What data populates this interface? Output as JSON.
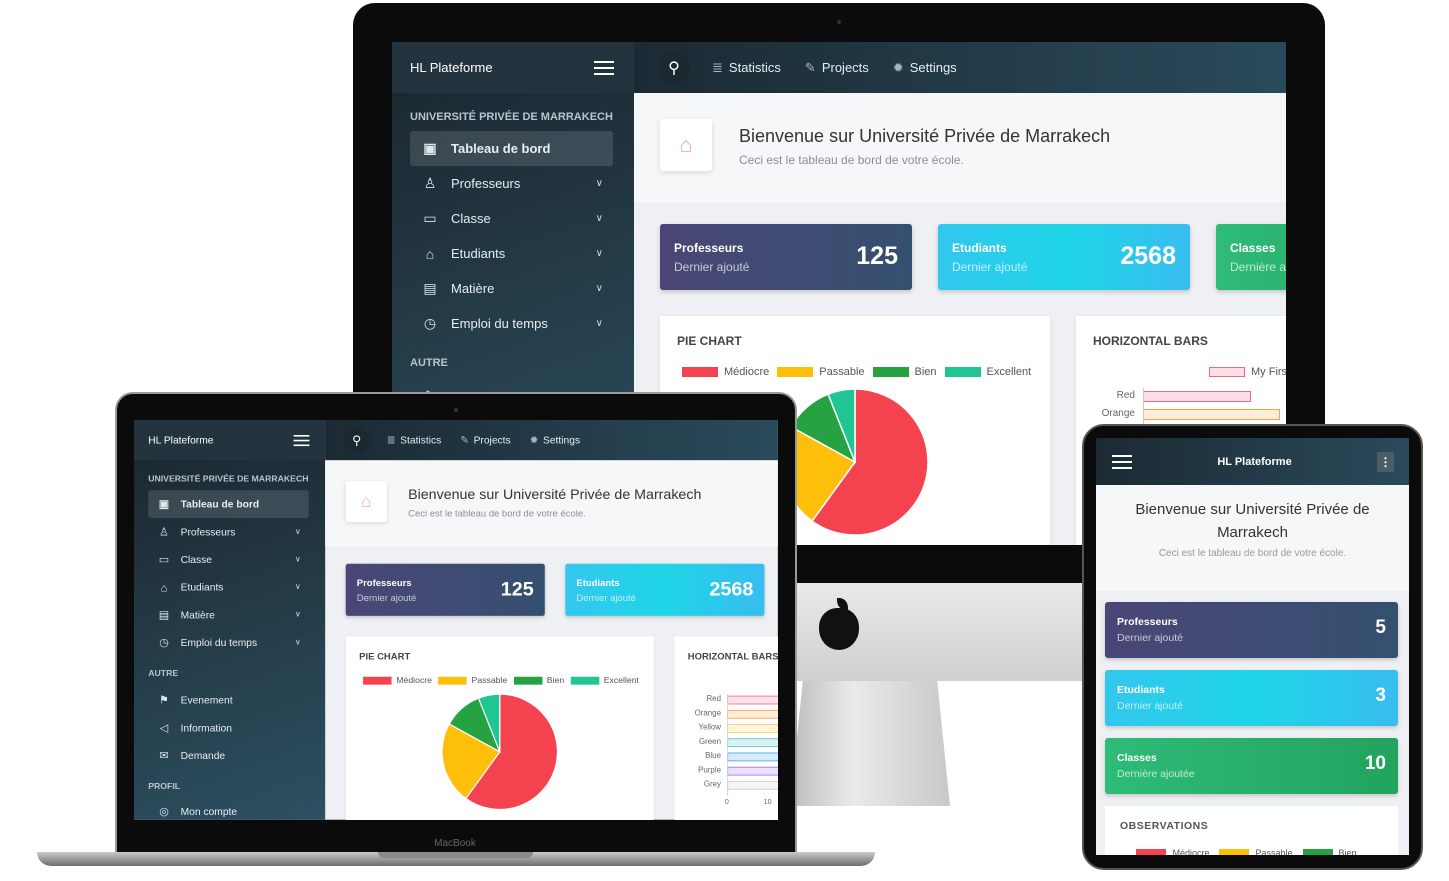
{
  "brand": "HL Plateforme",
  "sidebar": {
    "section_title": "UNIVERSITÉ PRIVÉE DE MARRAKECH",
    "items": [
      {
        "label": "Tableau de bord",
        "icon": "presentation-board-icon",
        "active": true
      },
      {
        "label": "Professeurs",
        "icon": "users-icon"
      },
      {
        "label": "Classe",
        "icon": "folder-icon"
      },
      {
        "label": "Etudiants",
        "icon": "graduation-cap-icon"
      },
      {
        "label": "Matière",
        "icon": "clipboard-icon"
      },
      {
        "label": "Emploi du temps",
        "icon": "alarm-clock-icon"
      }
    ],
    "other_title": "AUTRE",
    "other_items": [
      {
        "label": "Evenement",
        "icon": "signpost-icon"
      },
      {
        "label": "Information",
        "icon": "megaphone-icon"
      },
      {
        "label": "Demande",
        "icon": "envelope-icon"
      }
    ],
    "profile_title": "PROFIL",
    "profile_items": [
      {
        "label": "Mon compte",
        "icon": "user-circle-icon"
      }
    ]
  },
  "topnav": [
    {
      "label": "Statistics",
      "icon": "database-icon"
    },
    {
      "label": "Projects",
      "icon": "edit-icon"
    },
    {
      "label": "Settings",
      "icon": "gear-icon"
    }
  ],
  "welcome": {
    "title": "Bienvenue sur Université Privée de Marrakech",
    "subtitle": "Ceci est le tableau de bord de votre école."
  },
  "stats": [
    {
      "title": "Professeurs",
      "subtitle": "Dernier ajouté",
      "value": "125",
      "color": "#4a4677"
    },
    {
      "title": "Etudiants",
      "subtitle": "Dernier ajouté",
      "value": "2568",
      "color": "#1ed5e6"
    },
    {
      "title": "Classes",
      "subtitle": "Dernière ajoutée",
      "value": "10",
      "color": "#2fbb78"
    }
  ],
  "tablet_stats": [
    {
      "title": "Professeurs",
      "subtitle": "Dernier ajouté",
      "value": "5"
    },
    {
      "title": "Etudiants",
      "subtitle": "Dernier ajouté",
      "value": "3"
    },
    {
      "title": "Classes",
      "subtitle": "Dernière ajoutée",
      "value": "10"
    }
  ],
  "observations_title": "OBSERVATIONS",
  "device_label": "MacBook",
  "chart_data": [
    {
      "type": "pie",
      "title": "PIE CHART",
      "categories": [
        "Médiocre",
        "Passable",
        "Bien",
        "Excellent"
      ],
      "values": [
        60,
        23,
        11,
        6
      ],
      "colors": [
        "#f5424f",
        "#fdbf0a",
        "#27a243",
        "#1fc593"
      ],
      "legend": "top"
    },
    {
      "type": "bar",
      "orientation": "horizontal",
      "title": "HORIZONTAL BARS",
      "series": [
        {
          "name": "My First"
        }
      ],
      "categories": [
        "Red",
        "Orange",
        "Yellow",
        "Green",
        "Blue",
        "Purple",
        "Grey"
      ],
      "values": [
        22,
        28,
        28,
        28,
        28,
        28,
        28
      ],
      "colors": [
        "#ff6384",
        "#ff9f40",
        "#ffcd56",
        "#4bc0c0",
        "#36a2eb",
        "#9966ff",
        "#c9cbcf"
      ],
      "xticks": [
        "0",
        "10"
      ],
      "legend": "top"
    }
  ]
}
